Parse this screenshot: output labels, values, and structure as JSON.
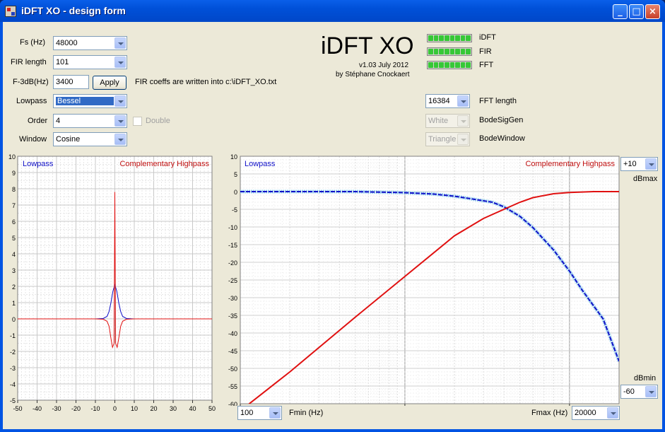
{
  "window": {
    "title": "iDFT XO - design form",
    "minimize": "_",
    "maximize": "□",
    "close": "×"
  },
  "header": {
    "app_name": "iDFT XO",
    "version": "v1.03 July 2012",
    "author": "by Stéphane Cnockaert"
  },
  "indicators": [
    {
      "label": "iDFT"
    },
    {
      "label": "FIR"
    },
    {
      "label": "FFT"
    }
  ],
  "form": {
    "fs_label": "Fs (Hz)",
    "fs_value": "48000",
    "fir_label": "FIR length",
    "fir_value": "101",
    "f3db_label": "F-3dB(Hz)",
    "f3db_value": "3400",
    "apply_label": "Apply",
    "fir_note": "FIR coeffs are written into c:\\iDFT_XO.txt",
    "lowpass_label": "Lowpass",
    "lowpass_value": "Bessel",
    "order_label": "Order",
    "order_value": "4",
    "double_label": "Double",
    "window_label": "Window",
    "window_value": "Cosine",
    "fft_value": "16384",
    "fft_label": "FFT length",
    "bodesig_value": "White",
    "bodesig_label": "BodeSigGen",
    "bodewin_value": "Triangle",
    "bodewin_label": "BodeWindow"
  },
  "impulse_chart": {
    "legend_left": "Lowpass",
    "legend_right": "Complementary Highpass",
    "y_ticks": [
      "10",
      "9",
      "8",
      "7",
      "6",
      "5",
      "4",
      "3",
      "2",
      "1",
      "0",
      "-1",
      "-2",
      "-3",
      "-4",
      "-5"
    ],
    "x_ticks": [
      "-50",
      "-40",
      "-30",
      "-20",
      "-10",
      "0",
      "10",
      "20",
      "30",
      "40",
      "50"
    ]
  },
  "bode_chart": {
    "legend_left": "Lowpass",
    "legend_right": "Complementary Highpass",
    "y_ticks": [
      "10",
      "5",
      "0",
      "-5",
      "-10",
      "-15",
      "-20",
      "-25",
      "-30",
      "-35",
      "-40",
      "-45",
      "-50",
      "-55",
      "-60"
    ],
    "dbmax_value": "+10",
    "dbmax_label": "dBmax",
    "dbmin_label": "dBmin",
    "dbmin_value": "-60",
    "fmin_value": "100",
    "fmin_label": "Fmin (Hz)",
    "fmax_label": "Fmax (Hz)",
    "fmax_value": "20000"
  },
  "colors": {
    "lowpass": "#1010c8",
    "highpass": "#e01010",
    "bode_lowpass_dots": "#9fd4ef"
  },
  "chart_data": [
    {
      "type": "line",
      "xlim": [
        -50,
        50
      ],
      "ylim": [
        -5,
        10
      ],
      "grid": true,
      "series": [
        {
          "name": "Lowpass",
          "x": [
            -50,
            -10,
            -6,
            -4,
            -3,
            -2,
            -1,
            0,
            1,
            2,
            3,
            4,
            6,
            10,
            50
          ],
          "y": [
            0,
            0,
            0.02,
            0.15,
            0.45,
            1.0,
            1.7,
            2.1,
            1.7,
            1.0,
            0.45,
            0.15,
            0.02,
            0,
            0
          ]
        },
        {
          "name": "Complementary Highpass",
          "x": [
            -50,
            -10,
            -6,
            -4,
            -3,
            -2,
            -1.2,
            -0.4,
            0,
            0.4,
            1.2,
            2,
            3,
            4,
            6,
            10,
            50
          ],
          "y": [
            0,
            0,
            -0.02,
            -0.15,
            -0.45,
            -1.2,
            -1.75,
            -1.5,
            7.8,
            -1.5,
            -1.75,
            -1.2,
            -0.45,
            -0.15,
            -0.02,
            0,
            0
          ]
        }
      ]
    },
    {
      "type": "line",
      "x_scale": "log",
      "xlim": [
        100,
        20000
      ],
      "ylim": [
        -60,
        10
      ],
      "grid": true,
      "series": [
        {
          "name": "Lowpass",
          "x": [
            100,
            500,
            1000,
            1500,
            2000,
            2500,
            3000,
            3400,
            4000,
            5000,
            6000,
            8000,
            10000,
            12000,
            16000,
            20000
          ],
          "y": [
            0,
            0,
            -0.3,
            -0.7,
            -1.3,
            -2.0,
            -2.6,
            -3.0,
            -4.3,
            -7.0,
            -10.2,
            -16.5,
            -22.5,
            -28.0,
            -36.0,
            -48.0
          ]
        },
        {
          "name": "Complementary Highpass",
          "x": [
            100,
            200,
            500,
            1000,
            2000,
            3000,
            4000,
            5000,
            6000,
            8000,
            10000,
            14000,
            20000
          ],
          "y": [
            -62,
            -51,
            -35.5,
            -24,
            -12.5,
            -7.6,
            -5,
            -3,
            -1.7,
            -0.6,
            -0.25,
            0,
            0
          ]
        }
      ]
    }
  ]
}
